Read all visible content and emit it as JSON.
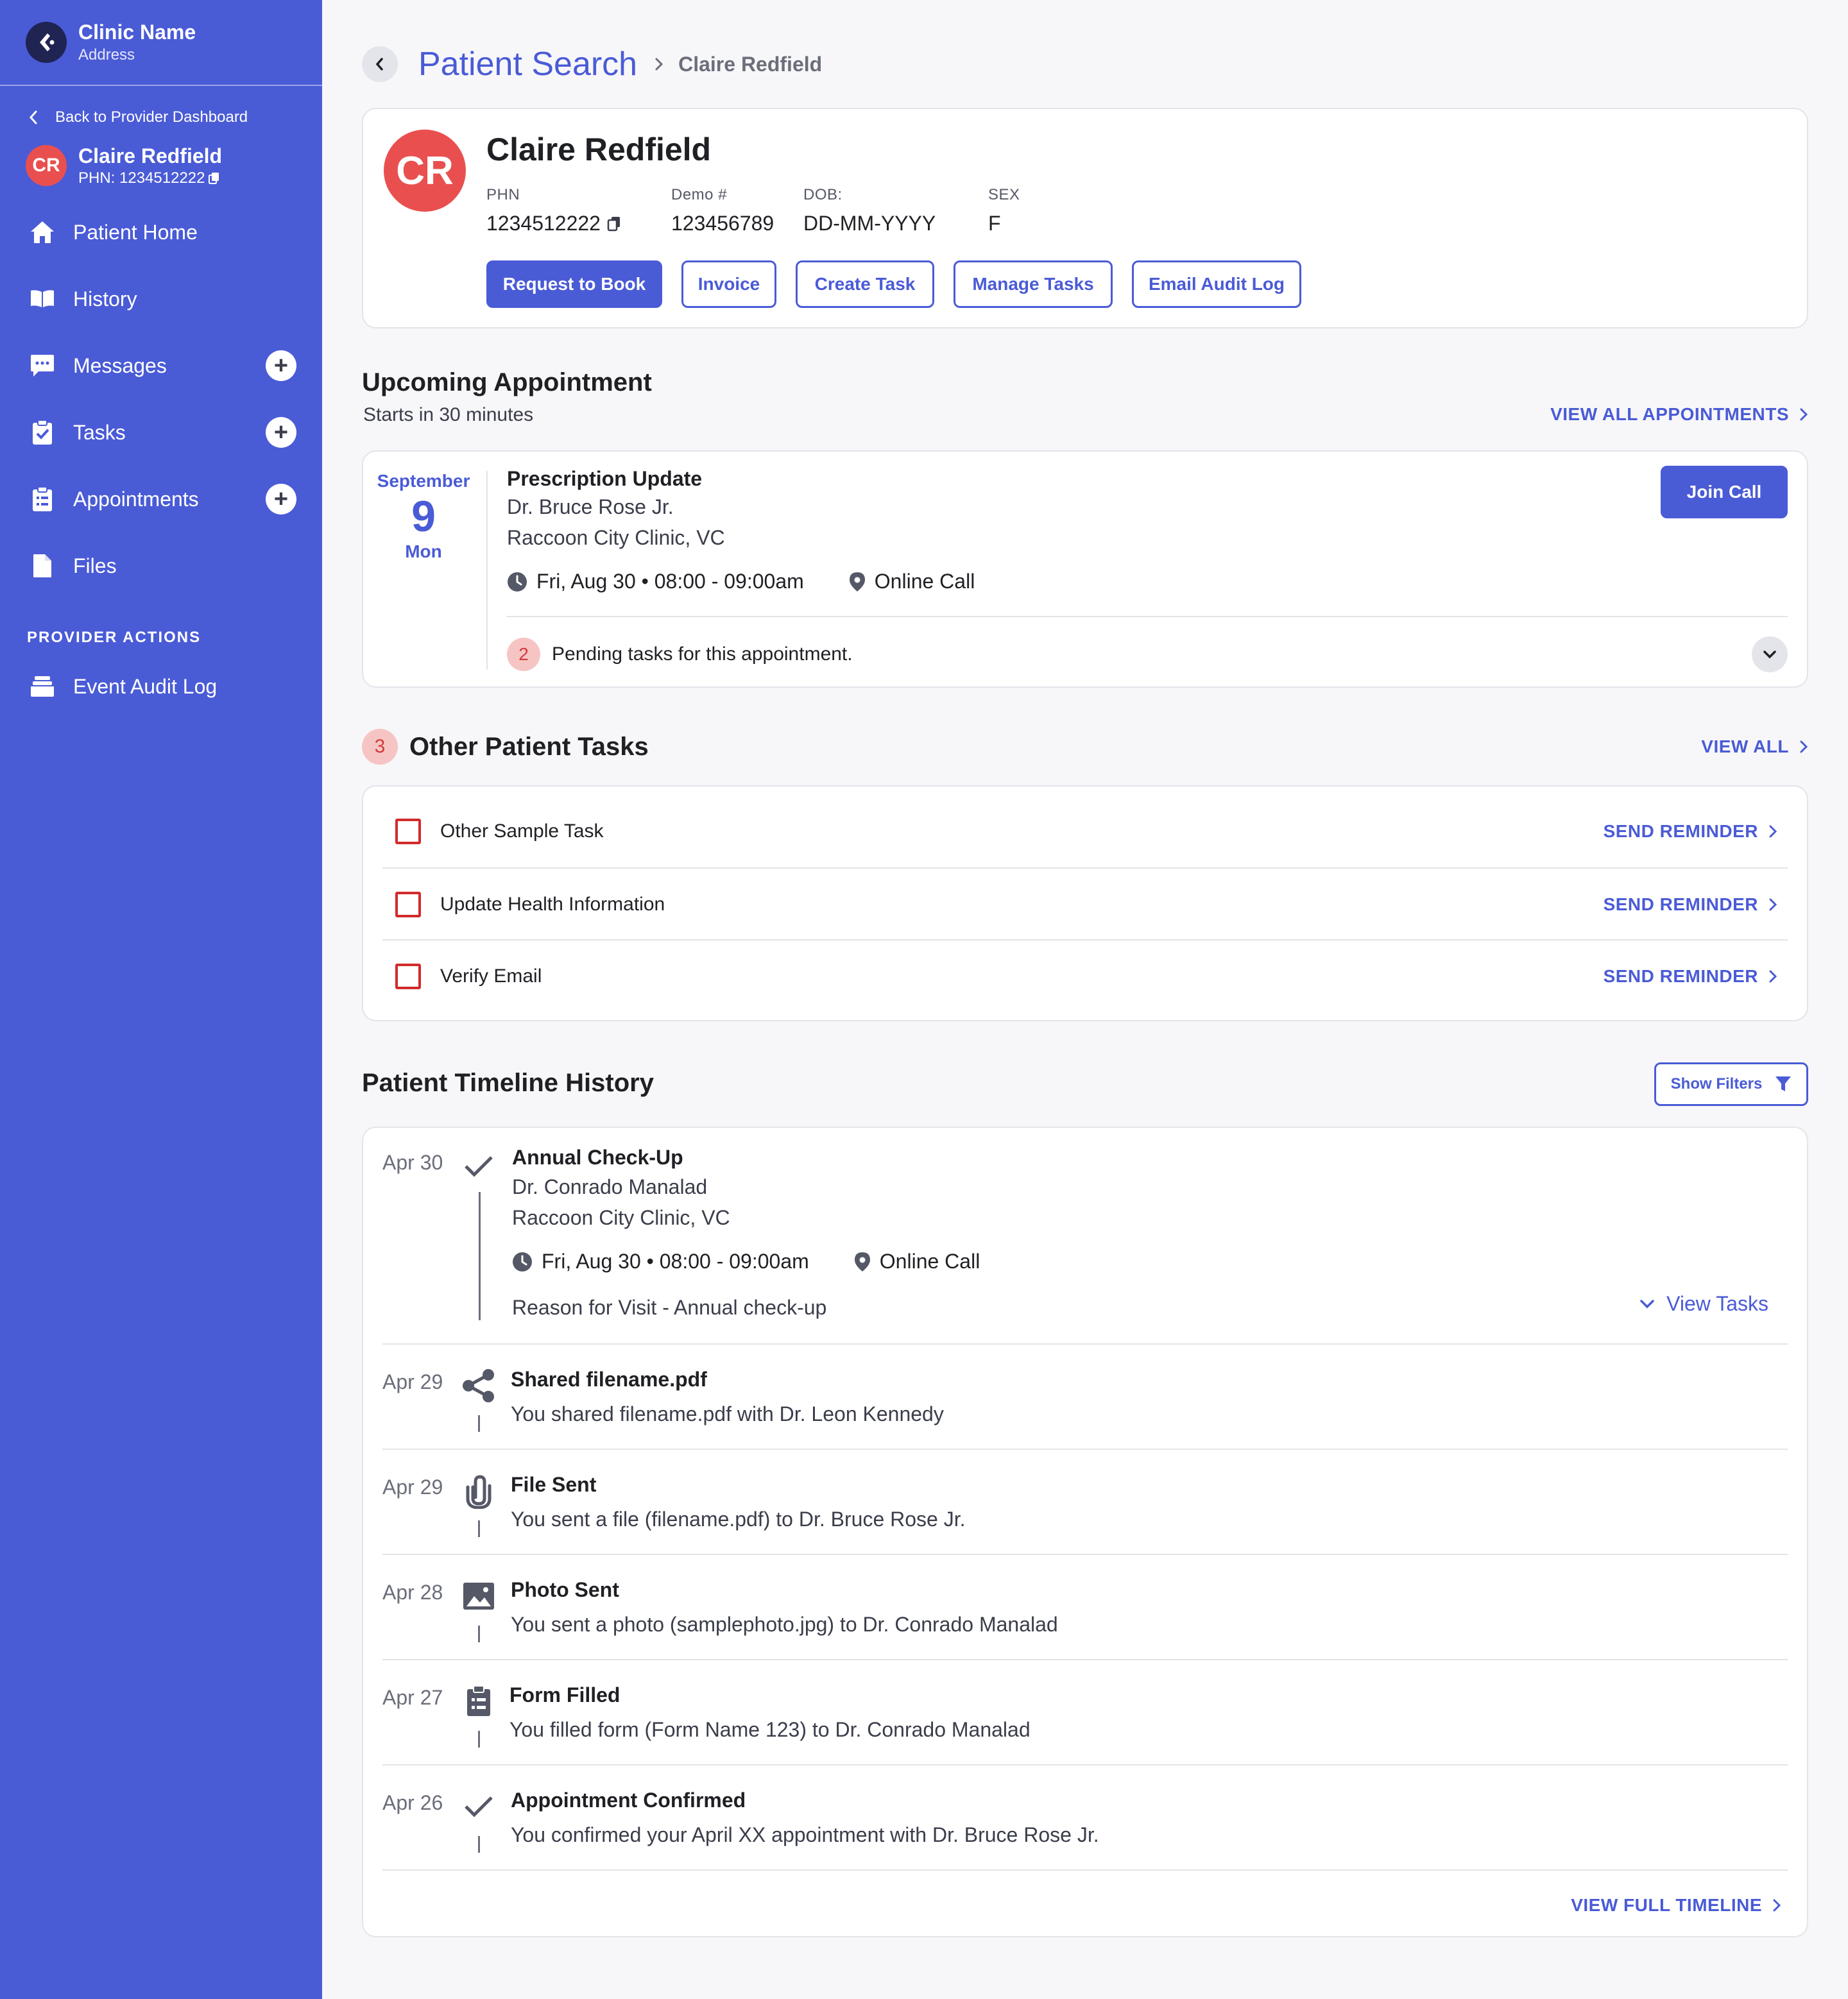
{
  "sidebar": {
    "clinic_name": "Clinic Name",
    "clinic_address": "Address",
    "back_label": "Back to Provider Dashboard",
    "patient": {
      "initials": "CR",
      "name": "Claire Redfield",
      "phn": "PHN: 1234512222"
    },
    "nav": [
      {
        "label": "Patient Home",
        "icon": "home-icon"
      },
      {
        "label": "History",
        "icon": "book-icon"
      },
      {
        "label": "Messages",
        "icon": "chat-icon",
        "add": true
      },
      {
        "label": "Tasks",
        "icon": "clipboard-check-icon",
        "add": true
      },
      {
        "label": "Appointments",
        "icon": "clipboard-list-icon",
        "add": true
      },
      {
        "label": "Files",
        "icon": "file-icon"
      }
    ],
    "section_provider_actions": "PROVIDER ACTIONS",
    "event_audit_log": "Event Audit Log"
  },
  "breadcrumb": {
    "title": "Patient Search",
    "current": "Claire Redfield"
  },
  "patient_header": {
    "initials": "CR",
    "name": "Claire Redfield",
    "fields": [
      {
        "label": "PHN",
        "value": "1234512222"
      },
      {
        "label": "Demo #",
        "value": "123456789"
      },
      {
        "label": "DOB:",
        "value": "DD-MM-YYYY"
      },
      {
        "label": "SEX",
        "value": "F"
      }
    ],
    "actions": [
      "Request to Book",
      "Invoice",
      "Create Task",
      "Manage Tasks",
      "Email Audit Log"
    ]
  },
  "upcoming": {
    "heading": "Upcoming Appointment",
    "subheading": "Starts in 30 minutes",
    "view_all": "VIEW ALL APPOINTMENTS",
    "month": "September",
    "day": "9",
    "weekday": "Mon",
    "title": "Prescription Update",
    "doctor": "Dr. Bruce Rose Jr.",
    "clinic": "Raccoon City Clinic, VC",
    "time": "Fri, Aug 30 • 08:00 - 09:00am",
    "location": "Online Call",
    "join_label": "Join Call",
    "pending_count": "2",
    "pending_text": "Pending tasks for this appointment."
  },
  "other_tasks": {
    "count": "3",
    "heading": "Other Patient Tasks",
    "view_all": "VIEW ALL",
    "reminder_label": "SEND REMINDER",
    "items": [
      "Other Sample Task",
      "Update Health Information",
      "Verify Email"
    ]
  },
  "timeline": {
    "heading": "Patient Timeline History",
    "filter_label": "Show Filters",
    "first": {
      "date": "Apr 30",
      "title": "Annual Check-Up",
      "doctor": "Dr. Conrado Manalad",
      "clinic": "Raccoon City Clinic, VC",
      "time": "Fri, Aug 30 • 08:00 - 09:00am",
      "location": "Online Call",
      "reason": "Reason for Visit - Annual check-up",
      "view_tasks": "View Tasks"
    },
    "entries": [
      {
        "date": "Apr 29",
        "icon": "share-icon",
        "title": "Shared filename.pdf",
        "text": "You shared filename.pdf with Dr. Leon Kennedy"
      },
      {
        "date": "Apr 29",
        "icon": "paperclip-icon",
        "title": "File Sent",
        "text": "You sent a file (filename.pdf) to Dr. Bruce Rose Jr."
      },
      {
        "date": "Apr 28",
        "icon": "image-icon",
        "title": "Photo Sent",
        "text": "You sent a photo (samplephoto.jpg) to Dr. Conrado Manalad"
      },
      {
        "date": "Apr 27",
        "icon": "clipboard-list-icon",
        "title": "Form Filled",
        "text": "You filled form (Form Name 123) to Dr. Conrado Manalad"
      },
      {
        "date": "Apr 26",
        "icon": "check-icon",
        "title": "Appointment Confirmed",
        "text": "You confirmed your April XX appointment with Dr. Bruce Rose Jr."
      }
    ],
    "view_full": "VIEW FULL TIMELINE"
  },
  "colors": {
    "brand": "#4a5bd6",
    "avatar": "#ea4f4f",
    "task_checkbox": "#d22b2b"
  }
}
